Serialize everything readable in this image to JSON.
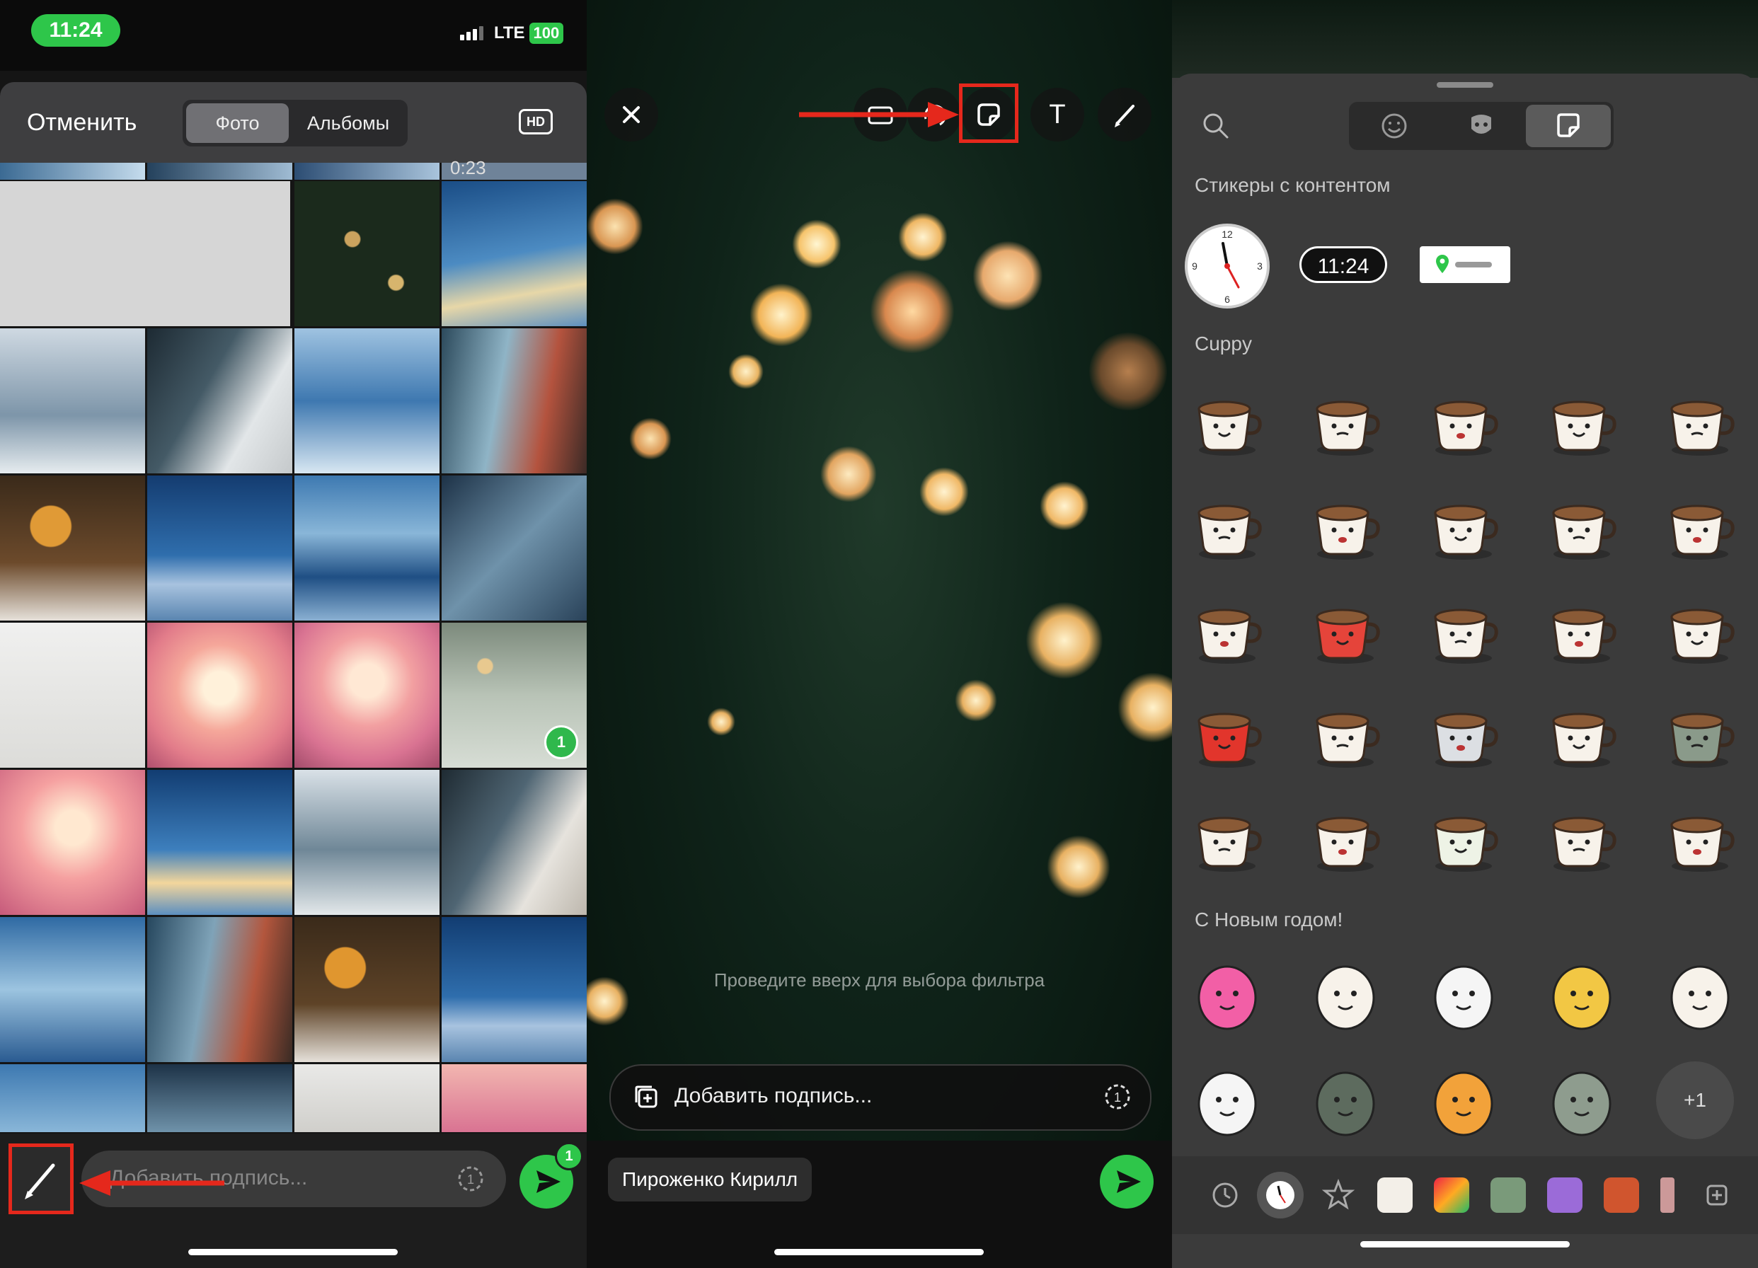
{
  "status_bar": {
    "time": "11:24",
    "network": "LTE",
    "battery": "100"
  },
  "picker": {
    "cancel_label": "Отменить",
    "tabs": [
      {
        "label": "Фото",
        "active": true
      },
      {
        "label": "Альбомы",
        "active": false
      }
    ],
    "hd_label": "HD",
    "video_duration": "0:23",
    "selected_badge": "1",
    "caption_placeholder": "Добавить подпись...",
    "send_count": "1",
    "edit_icon": "pencil-icon"
  },
  "editor": {
    "tools": [
      "close-icon",
      "crop-icon",
      "rotate-icon",
      "sticker-icon",
      "text-icon",
      "draw-icon"
    ],
    "text_tool_label": "T",
    "hint": "Проведите вверх для выбора фильтра",
    "caption_placeholder": "Добавить подпись...",
    "recipient": "Пироженко Кирилл"
  },
  "sticker_panel": {
    "tabs": [
      "emoji-icon",
      "mask-icon",
      "sticker-icon"
    ],
    "sections": {
      "content": "Стикеры с контентом",
      "cuppy": "Cuppy",
      "new_year": "С Новым годом!"
    },
    "content_stickers": {
      "clock_label": "analog-clock",
      "time_chip": "11:24",
      "location": "location-pin-icon"
    },
    "more_label": "+1"
  },
  "colors": {
    "accent_green": "#2ec64a",
    "highlight_red": "#e5281c"
  }
}
